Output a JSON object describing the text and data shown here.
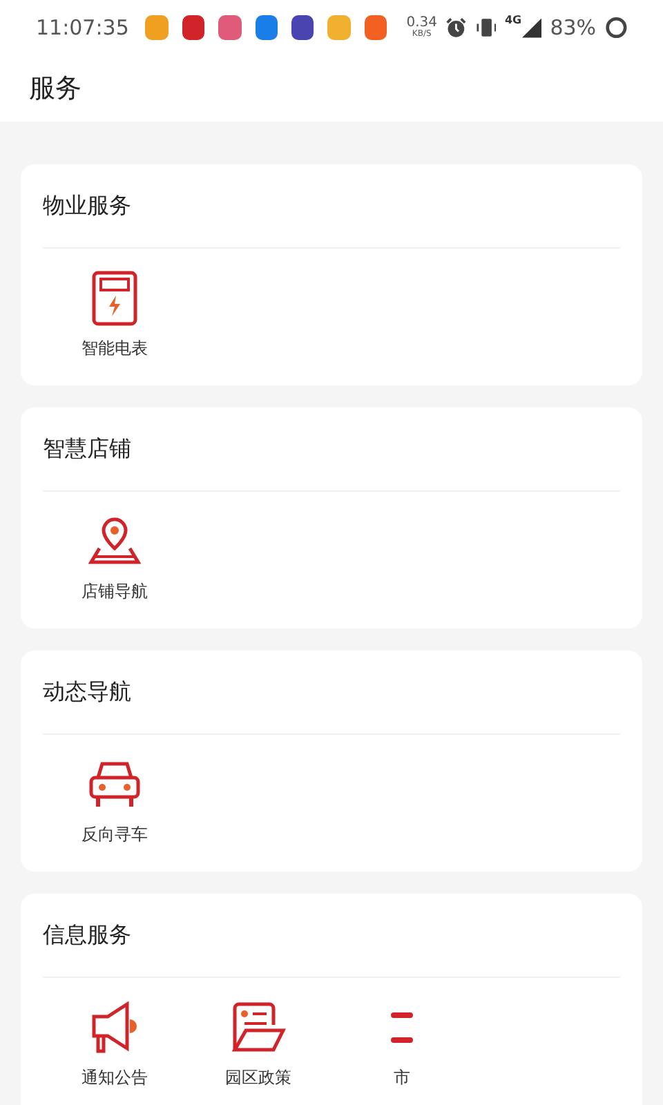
{
  "status_bar": {
    "time": "11:07:35",
    "notifications": [
      {
        "color": "#f0a020"
      },
      {
        "color": "#d0242a"
      },
      {
        "color": "#e05a7a"
      },
      {
        "color": "#1a7ee8"
      },
      {
        "color": "#4a44b0"
      },
      {
        "color": "#f2b030"
      },
      {
        "color": "#f06020"
      }
    ],
    "speed": "0.34",
    "speed_unit": "KB/S",
    "network": "4G",
    "battery": "83%"
  },
  "header": {
    "title": "服务"
  },
  "sections": [
    {
      "title": "物业服务",
      "items": [
        {
          "kind": "meter",
          "label": "智能电表"
        }
      ]
    },
    {
      "title": "智慧店铺",
      "items": [
        {
          "kind": "pin",
          "label": "店铺导航"
        }
      ]
    },
    {
      "title": "动态导航",
      "items": [
        {
          "kind": "car",
          "label": "反向寻车"
        }
      ]
    },
    {
      "title": "信息服务",
      "items": [
        {
          "kind": "megaphone",
          "label": "通知公告"
        },
        {
          "kind": "document",
          "label": "园区政策"
        },
        {
          "kind": "partial",
          "label": "市"
        }
      ]
    }
  ]
}
